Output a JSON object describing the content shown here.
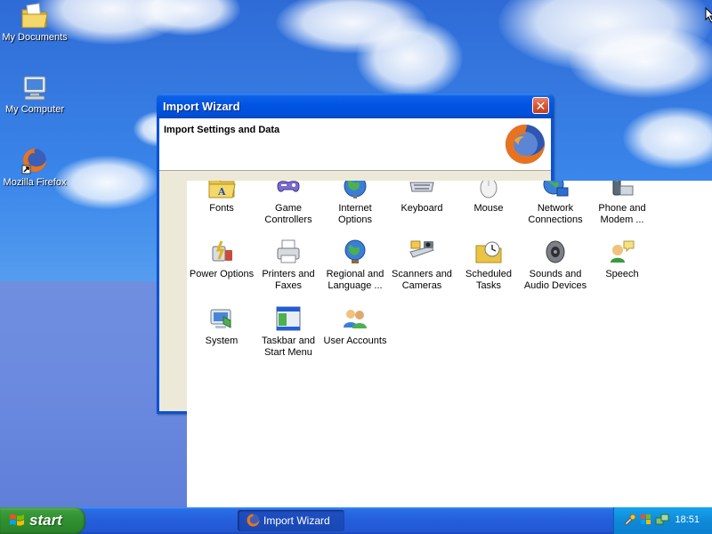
{
  "desktop": {
    "icons": [
      {
        "label": "My Documents"
      },
      {
        "label": "My Computer"
      },
      {
        "label": "Mozilla Firefox"
      }
    ]
  },
  "wizard": {
    "title": "Import Wizard",
    "close_glyph": "✕",
    "heading": "Import Settings and Data",
    "logo_icon": "firefox-icon"
  },
  "control_panel": {
    "items": [
      {
        "label": "Fonts",
        "icon": "fonts-folder-icon"
      },
      {
        "label": "Game Controllers",
        "icon": "gamepad-icon"
      },
      {
        "label": "Internet Options",
        "icon": "globe-icon"
      },
      {
        "label": "Keyboard",
        "icon": "keyboard-icon"
      },
      {
        "label": "Mouse",
        "icon": "mouse-icon"
      },
      {
        "label": "Network Connections",
        "icon": "network-icon"
      },
      {
        "label": "Phone and Modem ...",
        "icon": "phone-icon"
      },
      {
        "label": "Power Options",
        "icon": "power-icon"
      },
      {
        "label": "Printers and Faxes",
        "icon": "printer-icon"
      },
      {
        "label": "Regional and Language ...",
        "icon": "regional-globe-icon"
      },
      {
        "label": "Scanners and Cameras",
        "icon": "scanner-icon"
      },
      {
        "label": "Scheduled Tasks",
        "icon": "scheduled-tasks-icon"
      },
      {
        "label": "Sounds and Audio Devices",
        "icon": "speaker-icon"
      },
      {
        "label": "Speech",
        "icon": "speech-icon"
      },
      {
        "label": "System",
        "icon": "system-icon"
      },
      {
        "label": "Taskbar and Start Menu",
        "icon": "taskbar-icon"
      },
      {
        "label": "User Accounts",
        "icon": "users-icon"
      }
    ]
  },
  "taskbar": {
    "start_label": "start",
    "tasks": [
      {
        "label": "Import Wizard"
      }
    ],
    "clock": "18:51"
  },
  "colors": {
    "titlebar": "#0054e3",
    "taskbar": "#245edb",
    "start_button": "#3c9b3c",
    "tray": "#0f8ad9"
  }
}
